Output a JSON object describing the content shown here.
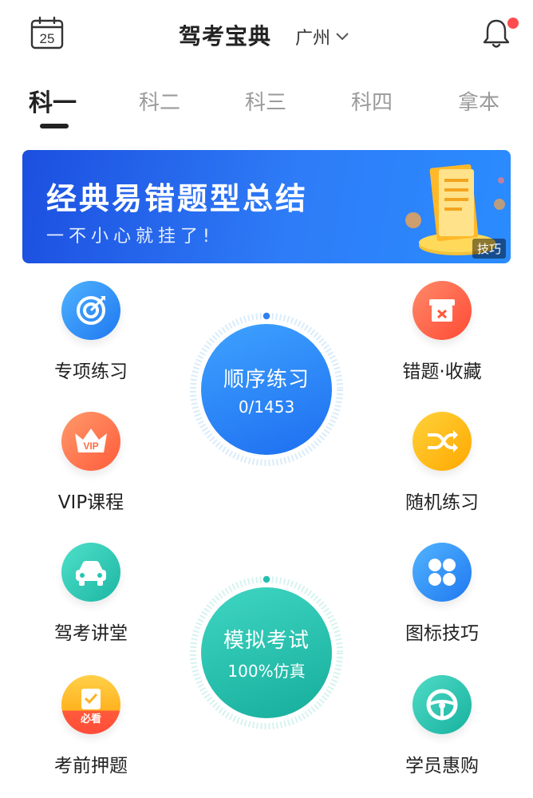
{
  "header": {
    "calendar_day": "25",
    "title": "驾考宝典",
    "city": "广州",
    "notification_dot_color": "#ff4d4f"
  },
  "tabs": [
    {
      "label": "科一",
      "active": true
    },
    {
      "label": "科二",
      "active": false
    },
    {
      "label": "科三",
      "active": false
    },
    {
      "label": "科四",
      "active": false
    },
    {
      "label": "拿本",
      "active": false
    }
  ],
  "banner": {
    "title": "经典易错题型总结",
    "subtitle": "一不小心就挂了!",
    "tag": "技巧"
  },
  "left_items": [
    {
      "label": "专项练习",
      "icon": "target-icon",
      "color": "#2f8cf5"
    },
    {
      "label": "VIP课程",
      "icon": "vip-crown-icon",
      "color": "#ff6a3d"
    },
    {
      "label": "驾考讲堂",
      "icon": "car-icon",
      "color": "#25c7b2"
    },
    {
      "label": "考前押题",
      "icon": "checklist-icon",
      "color": "#ffb21e",
      "badge": "必看"
    }
  ],
  "right_items": [
    {
      "label": "错题·收藏",
      "icon": "wrong-box-icon",
      "color": "#ff5a3a"
    },
    {
      "label": "随机练习",
      "icon": "shuffle-icon",
      "color": "#ffb300"
    },
    {
      "label": "图标技巧",
      "icon": "grid-dots-icon",
      "color": "#2f8cf5"
    },
    {
      "label": "学员惠购",
      "icon": "steering-wheel-icon",
      "color": "#22c1b0"
    }
  ],
  "sequential_practice": {
    "title": "顺序练习",
    "progress": "0/1453",
    "color": "#2f80f3"
  },
  "mock_exam": {
    "title": "模拟考试",
    "subtitle": "100%仿真",
    "color": "#23bfae"
  }
}
